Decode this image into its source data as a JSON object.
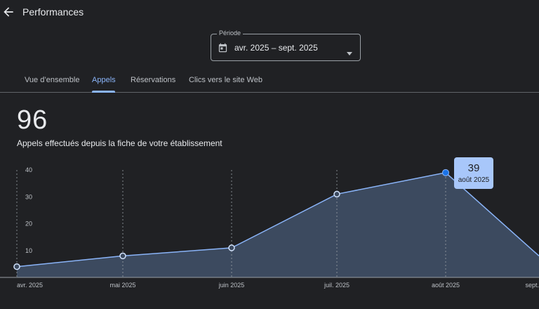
{
  "header": {
    "title": "Performances",
    "back_icon": "arrow-back-icon"
  },
  "period": {
    "label": "Période",
    "value": "avr. 2025 – sept. 2025",
    "calendar_icon": "calendar-icon",
    "dropdown_icon": "caret-down-icon"
  },
  "tabs": [
    {
      "label": "Vue d’ensemble",
      "active": false
    },
    {
      "label": "Appels",
      "active": true
    },
    {
      "label": "Réservations",
      "active": false
    },
    {
      "label": "Clics vers le site Web",
      "active": false
    }
  ],
  "summary": {
    "total": "96",
    "description": "Appels effectués depuis la fiche de votre établissement"
  },
  "tooltip": {
    "value": "39",
    "date": "août 2025"
  },
  "colors": {
    "background": "#202124",
    "accent": "#8ab4f8",
    "area_fill": "#3c4a5f",
    "tooltip_bg": "#a8c7fa",
    "highlight_point": "#1a73e8"
  },
  "chart_data": {
    "type": "area",
    "categories": [
      "avr. 2025",
      "mai 2025",
      "juin 2025",
      "juil. 2025",
      "août 2025",
      "sept."
    ],
    "series": [
      {
        "values": [
          4,
          8,
          11,
          31,
          39,
          8
        ]
      }
    ],
    "ylim": [
      0,
      40
    ],
    "yticks": [
      10,
      20,
      30,
      40
    ],
    "highlight_index": 4,
    "grid": "vertical-dashed"
  }
}
